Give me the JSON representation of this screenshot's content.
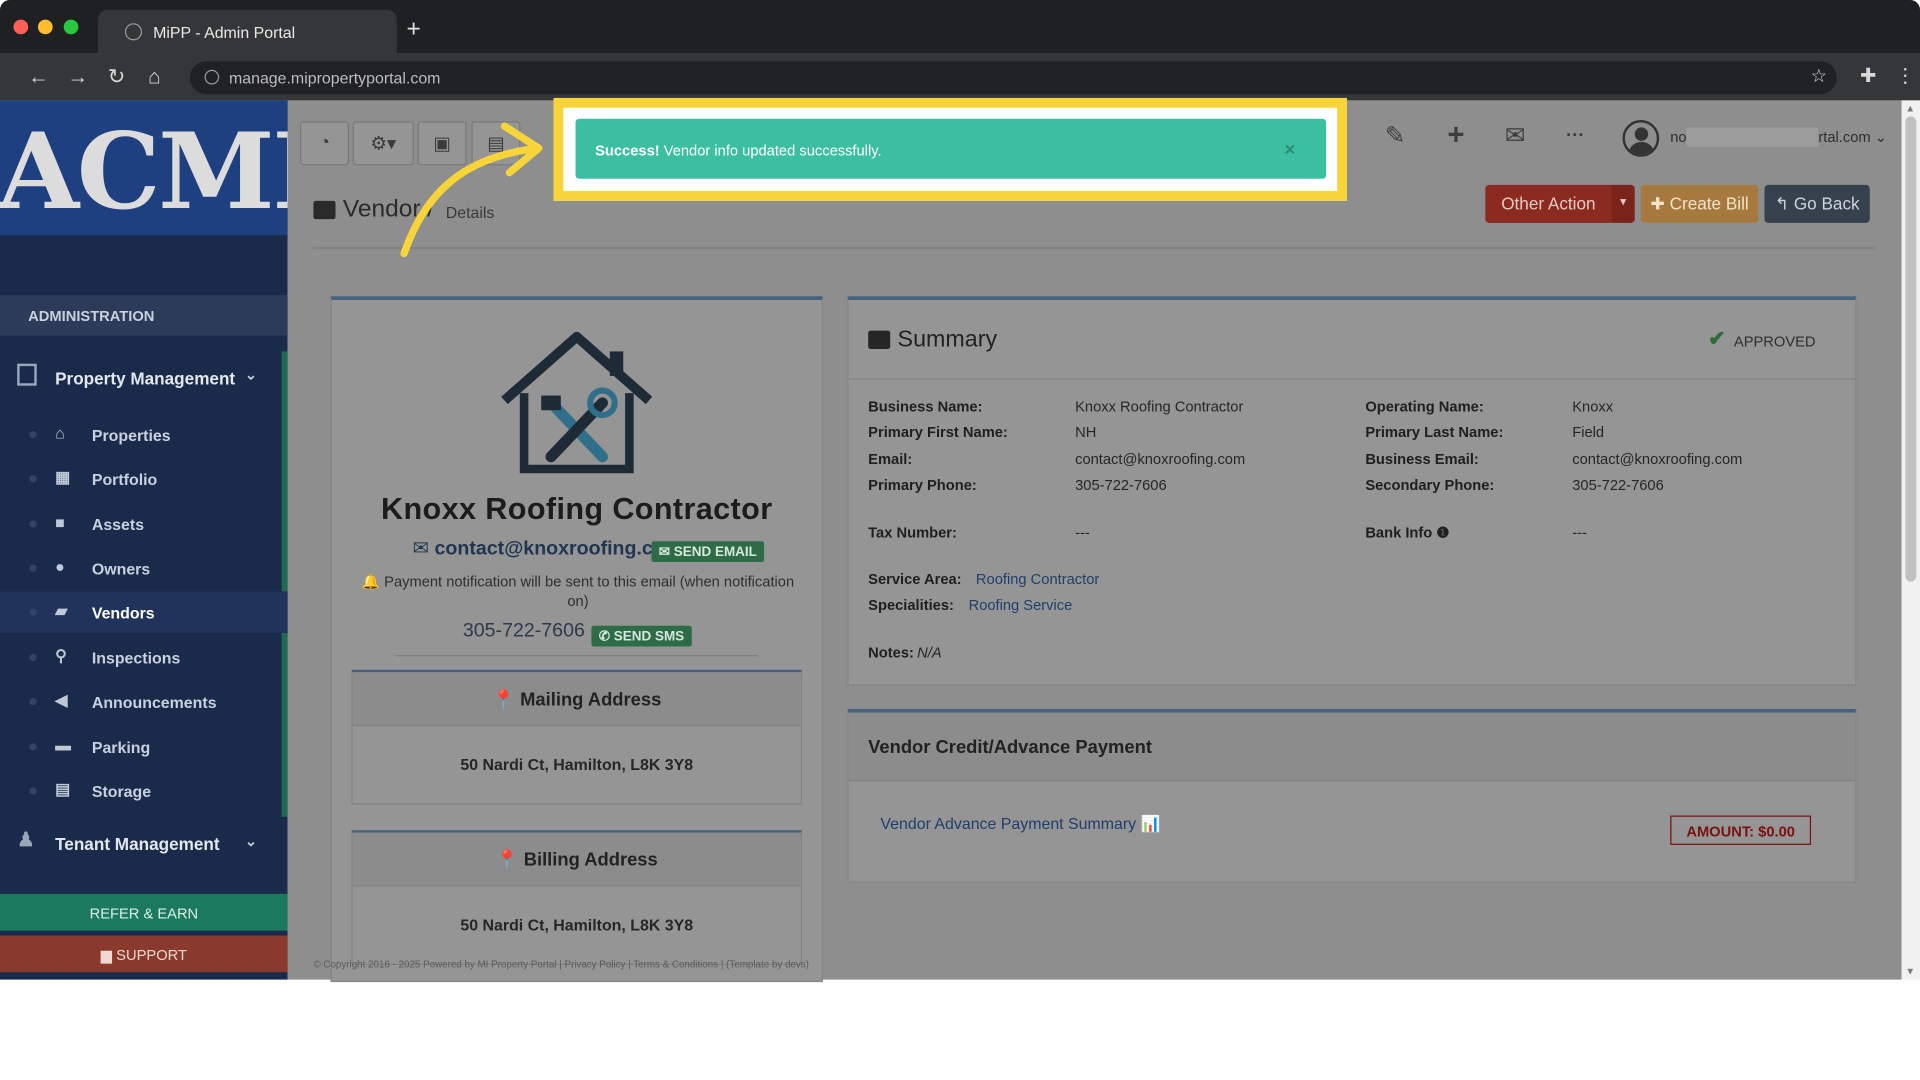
{
  "browser": {
    "tab_title": "MiPP - Admin Portal",
    "url": "manage.mipropertyportal.com",
    "new_tab": "+",
    "nav": {
      "back": "←",
      "forward": "→",
      "reload": "↻",
      "home": "⌂"
    },
    "bookmark_star": "☆",
    "extensions_icon": "✚",
    "menu_icon": "⋮"
  },
  "sidebar": {
    "logo_text": "ACME",
    "section_header": "ADMINISTRATION",
    "property_management": "Property Management",
    "chevron": "⌄",
    "items": [
      {
        "label": "Properties",
        "icon": "⌂"
      },
      {
        "label": "Portfolio",
        "icon": "▦"
      },
      {
        "label": "Assets",
        "icon": "■"
      },
      {
        "label": "Owners",
        "icon": "●"
      },
      {
        "label": "Vendors",
        "icon": "▰"
      },
      {
        "label": "Inspections",
        "icon": "⚲"
      },
      {
        "label": "Announcements",
        "icon": "◀"
      },
      {
        "label": "Parking",
        "icon": "▬"
      },
      {
        "label": "Storage",
        "icon": "▤"
      }
    ],
    "active_item": "Vendors",
    "tenant_management": "Tenant Management",
    "tenant_icon": "♟",
    "refer_earn": "REFER & EARN",
    "support": "▆ SUPPORT"
  },
  "topbar": {
    "dashboard_icon": "◔",
    "settings_icon": "⚙▾",
    "calendar_icon": "▣",
    "calc_icon": "▤",
    "chart_icon": "▮",
    "wrench_icon": "✎",
    "plus_icon": "+",
    "mail_icon": "✉",
    "more_icon": "···",
    "user_prefix": "no",
    "user_suffix": "rtal.com ⌄"
  },
  "toast": {
    "strong": "Success!",
    "message": " Vendor info updated successfully.",
    "close": "×"
  },
  "breadcrumb": {
    "title": "Vendor",
    "sep": " / ",
    "detail": "Details"
  },
  "actions": {
    "other_action": "Other Action",
    "other_caret": "▾",
    "create_bill": "✚ Create Bill",
    "go_back": "↰ Go Back"
  },
  "vendor": {
    "name": "Knoxx Roofing Contractor",
    "email": "contact@knoxroofing.com",
    "email_icon": "✉",
    "send_email": "✉ SEND EMAIL",
    "notice": "🔔 Payment notification will be sent to this email (when notification on)",
    "phone": "305-722-7606",
    "send_sms": "✆ SEND SMS",
    "mailing_title": "📍 Mailing Address",
    "mailing_address": "50 Nardi Ct, Hamilton, L8K 3Y8",
    "billing_title": "📍 Billing Address",
    "billing_address": "50 Nardi Ct, Hamilton, L8K 3Y8"
  },
  "summary": {
    "title": "Summary",
    "status": "APPROVED",
    "status_icon": "✔",
    "business_name_k": "Business Name:",
    "business_name_v": "Knoxx Roofing Contractor",
    "primary_first_k": "Primary First Name:",
    "primary_first_v": "NH",
    "email_k": "Email:",
    "email_v": "contact@knoxroofing.com",
    "primary_phone_k": "Primary Phone:",
    "primary_phone_v": "305-722-7606",
    "operating_name_k": "Operating Name:",
    "operating_name_v": "Knoxx",
    "primary_last_k": "Primary Last Name:",
    "primary_last_v": "Field",
    "business_email_k": "Business Email:",
    "business_email_v": "contact@knoxroofing.com",
    "secondary_phone_k": "Secondary Phone:",
    "secondary_phone_v": "305-722-7606",
    "tax_number_k": "Tax Number:",
    "tax_number_v": "---",
    "bank_info_k": "Bank Info ❶",
    "bank_info_v": "---",
    "service_area_k": "Service Area:",
    "service_area_v": "Roofing Contractor",
    "specialities_k": "Specialities:",
    "specialities_v": "Roofing Service",
    "notes_k": "Notes:",
    "notes_v": "N/A"
  },
  "credit": {
    "title": "Vendor Credit/Advance Payment",
    "link": "Vendor Advance Payment Summary 📊",
    "amount": "AMOUNT: $0.00"
  },
  "footer": "© Copyright 2016 - 2025 Powered by MI Property Portal | Privacy Policy | Terms & Conditions | (Template by devs)",
  "colors": {
    "highlight": "#f7d53a",
    "toast": "#3cbfa0",
    "danger": "#a83426",
    "warning": "#b8843a",
    "dark": "#3a4552"
  }
}
